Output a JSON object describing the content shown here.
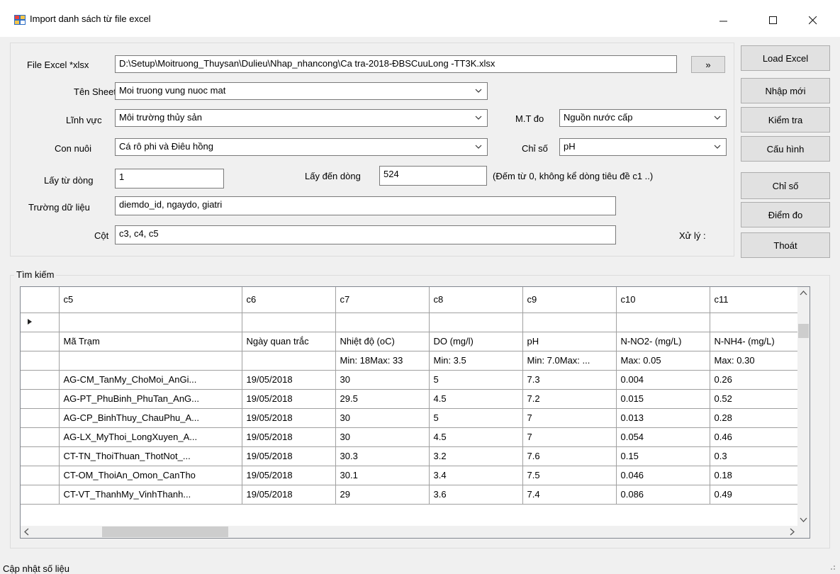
{
  "window": {
    "title": "Import danh sách từ file excel",
    "minimize": "—",
    "maximize": "☐",
    "close": "✕"
  },
  "form": {
    "file_label": "File Excel *xlsx",
    "file_value": "D:\\Setup\\Moitruong_Thuysan\\Dulieu\\Nhap_nhancong\\Ca tra-2018-ĐBSCuuLong -TT3K.xlsx",
    "browse": "»",
    "sheet_label": "Tên Sheet",
    "sheet_value": "Moi truong vung nuoc mat",
    "linhvuc_label": "Lĩnh vực",
    "linhvuc_value": "Môi trường thủy sản",
    "mtdo_label": "M.T đo",
    "mtdo_value": "Nguồn nước cấp",
    "connuoi_label": "Con nuôi",
    "connuoi_value": "Cá rô phi và Điêu hồng",
    "chiso_label": "Chỉ số",
    "chiso_value": "pH",
    "tudong_label": "Lấy từ dòng",
    "tudong_value": "1",
    "dendong_label": "Lấy đến dòng",
    "dendong_value": "524",
    "note": "(Đếm từ 0, không kể dòng tiêu đề c1 ..)",
    "truong_label": "Trường dữ liệu",
    "truong_value": "diemdo_id, ngaydo, giatri",
    "cot_label": "Cột",
    "cot_value": "c3, c4, c5",
    "xuly_label": "Xử lý :"
  },
  "buttons": {
    "load_excel": "Load Excel",
    "nhap_moi": "Nhập mới",
    "kiem_tra": "Kiểm tra",
    "cau_hinh": "Cấu hình",
    "chi_so": "Chỉ số",
    "diem_do": "Điểm đo",
    "thoat": "Thoát"
  },
  "search_group": "Tìm kiếm",
  "grid": {
    "columns": [
      "c5",
      "c6",
      "c7",
      "c8",
      "c9",
      "c10",
      "c11"
    ],
    "rows": [
      [
        "",
        "",
        "",
        "",
        "",
        "",
        ""
      ],
      [
        "Mã Trạm",
        "Ngày quan trắc",
        "Nhiệt độ (oC)",
        "DO (mg/l)",
        "pH",
        "N-NO2- (mg/L)",
        "N-NH4- (mg/L)"
      ],
      [
        "",
        "",
        "Min: 18Max: 33",
        "Min: 3.5",
        "Min: 7.0Max: ...",
        "Max: 0.05",
        "Max: 0.30"
      ],
      [
        "AG-CM_TanMy_ChoMoi_AnGi...",
        "19/05/2018",
        "30",
        "5",
        "7.3",
        "0.004",
        "0.26"
      ],
      [
        "AG-PT_PhuBinh_PhuTan_AnG...",
        "19/05/2018",
        "29.5",
        "4.5",
        "7.2",
        "0.015",
        "0.52"
      ],
      [
        "AG-CP_BinhThuy_ChauPhu_A...",
        "19/05/2018",
        "30",
        "5",
        "7",
        "0.013",
        "0.28"
      ],
      [
        "AG-LX_MyThoi_LongXuyen_A...",
        "19/05/2018",
        "30",
        "4.5",
        "7",
        "0.054",
        "0.46"
      ],
      [
        "CT-TN_ThoiThuan_ThotNot_...",
        "19/05/2018",
        "30.3",
        "3.2",
        "7.6",
        "0.15",
        "0.3"
      ],
      [
        "CT-OM_ThoiAn_Omon_CanTho",
        "19/05/2018",
        "30.1",
        "3.4",
        "7.5",
        "0.046",
        "0.18"
      ],
      [
        "CT-VT_ThanhMy_VinhThanh...",
        "19/05/2018",
        "29",
        "3.6",
        "7.4",
        "0.086",
        "0.49"
      ]
    ]
  },
  "status": "Cập nhật số liệu"
}
